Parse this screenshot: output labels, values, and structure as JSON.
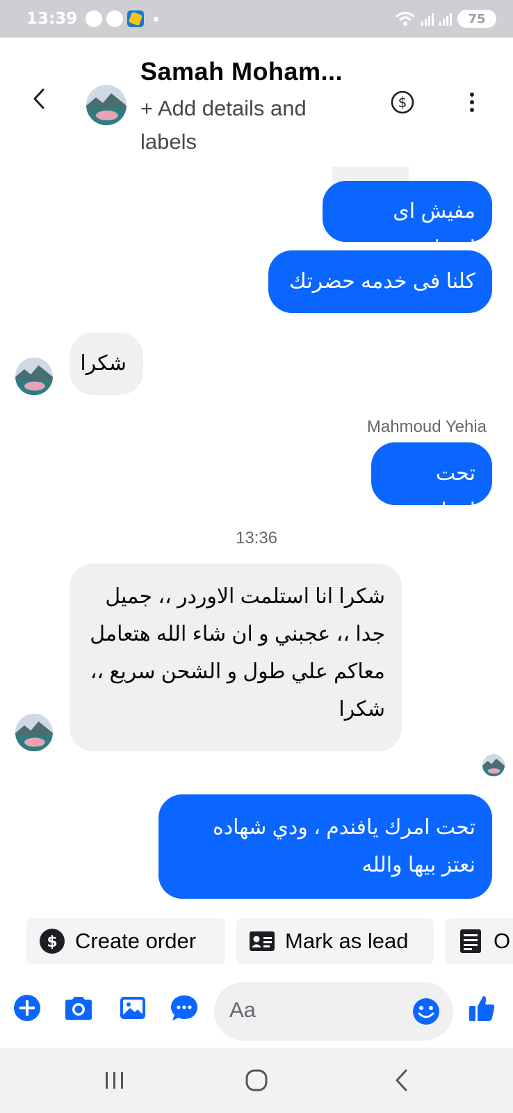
{
  "status_bar": {
    "time": "13:39",
    "battery": "75"
  },
  "header": {
    "contact_name": "Samah Moham...",
    "subtitle": "+ Add details and labels"
  },
  "messages": [
    {
      "direction": "outgoing",
      "text": "مفيش اى اعتذار"
    },
    {
      "direction": "outgoing",
      "text": "كلنا فى خدمه حضرتك"
    },
    {
      "direction": "incoming",
      "text": "شكرا"
    },
    {
      "direction": "outgoing",
      "sender": "Mahmoud Yehia",
      "text": "تحت امرك"
    },
    {
      "direction": "incoming",
      "timestamp": "13:36",
      "text": "شكرا انا استلمت الاوردر ،، جميل جدا ،، عجبني و ان شاء الله هتعامل معاكم علي طول و الشحن سريع ،، شكرا"
    },
    {
      "direction": "outgoing",
      "text": "تحت امرك يافندم ، ودي شهاده نعتز بيها والله"
    }
  ],
  "actions": [
    {
      "label": "Create order",
      "icon": "dollar-circle-icon"
    },
    {
      "label": "Mark as lead",
      "icon": "contact-card-icon"
    },
    {
      "label": "O",
      "icon": "document-icon"
    }
  ],
  "composer": {
    "placeholder": "Aa",
    "icons": [
      "plus-icon",
      "camera-icon",
      "gallery-icon",
      "chat-bubble-icon",
      "emoji-icon",
      "thumbs-up-icon"
    ]
  },
  "colors": {
    "accent": "#0a66ff",
    "incoming_bubble": "#f0f0f3",
    "status_bar": "#cfcfd3"
  }
}
